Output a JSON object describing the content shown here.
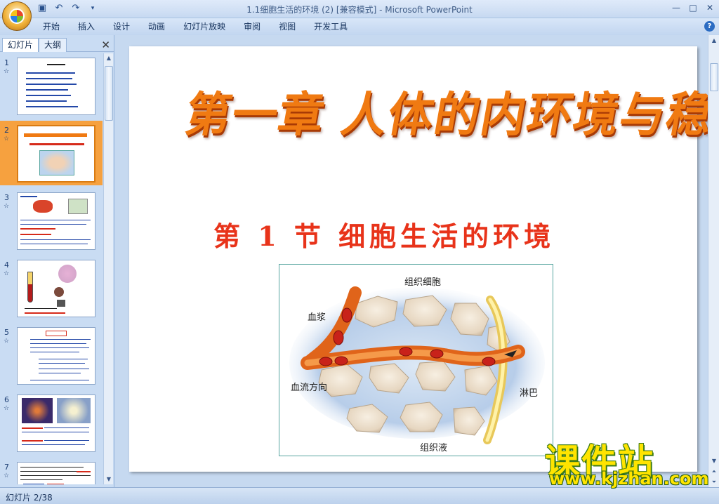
{
  "window": {
    "title": "1.1细胞生活的环境 (2) [兼容模式] - Microsoft PowerPoint",
    "controls": [
      "—",
      "□",
      "✕"
    ]
  },
  "quick_access": {
    "save_icon": "save-icon",
    "undo_icon": "undo-icon",
    "redo_icon": "redo-icon",
    "customize_icon": "customize-icon"
  },
  "ribbon": {
    "tabs": [
      "开始",
      "插入",
      "设计",
      "动画",
      "幻灯片放映",
      "审阅",
      "视图",
      "开发工具"
    ],
    "help": "?"
  },
  "left_pane": {
    "tabs": [
      "幻灯片",
      "大纲"
    ],
    "active_tab": "幻灯片",
    "close": "✕",
    "thumbnails": [
      {
        "number": "1",
        "star": "☆"
      },
      {
        "number": "2",
        "star": "☆",
        "selected": true
      },
      {
        "number": "3",
        "star": "☆"
      },
      {
        "number": "4",
        "star": "☆"
      },
      {
        "number": "5",
        "star": "☆"
      },
      {
        "number": "6",
        "star": "☆"
      },
      {
        "number": "7",
        "star": "☆"
      }
    ]
  },
  "slide": {
    "chapter_title": "第一章  人体的内环境与稳态",
    "section_title": "第 1 节   细胞生活的环境",
    "figure_labels": {
      "cells": "组织细胞",
      "plasma": "血浆",
      "flow": "血流方向",
      "lymph": "淋巴",
      "fluid": "组织液"
    }
  },
  "status": {
    "slide_counter": "幻灯片 2/38"
  },
  "watermark": {
    "title": "课件站",
    "url": "www.kjzhan.com"
  },
  "colors": {
    "chapter_title": "#f07a12",
    "section_title": "#e8331a",
    "selection": "#f6a13f",
    "watermark": "#ffe400"
  }
}
